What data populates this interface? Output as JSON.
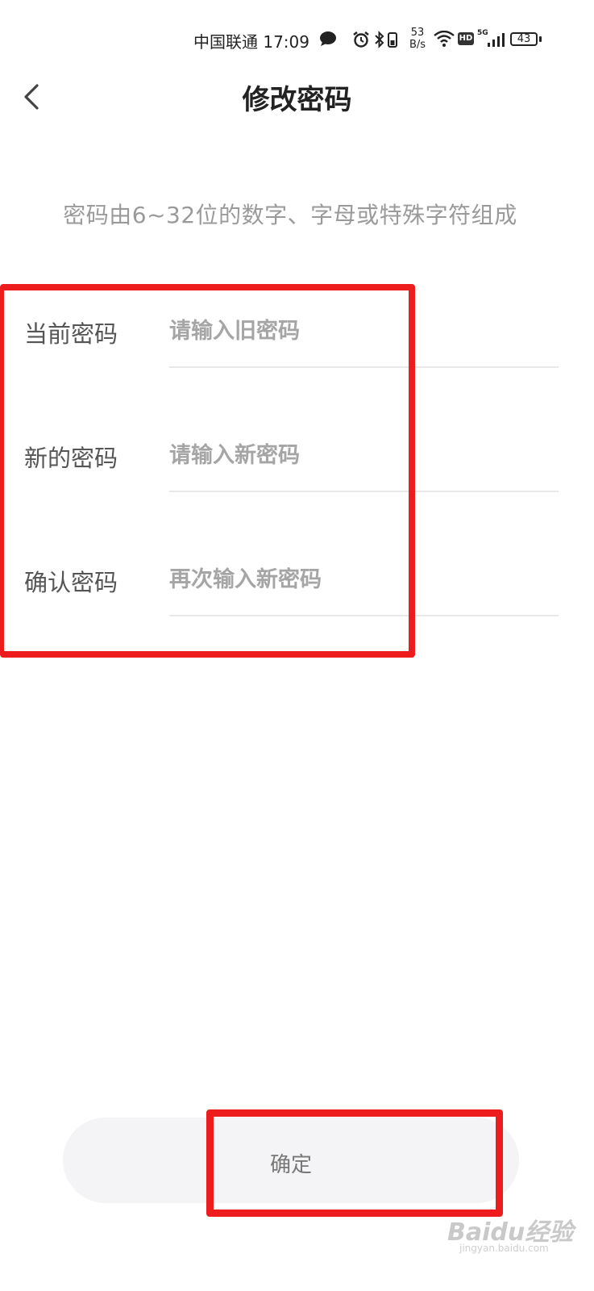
{
  "status_bar": {
    "carrier_time": "中国联通 17:09",
    "net_speed_value": "53",
    "net_speed_unit": "B/s",
    "hd": "HD",
    "signal_label": "5G",
    "battery": "43"
  },
  "header": {
    "title": "修改密码",
    "back_icon": "chevron-left-icon"
  },
  "hint": "密码由6~32位的数字、字母或特殊字符组成",
  "form": {
    "current": {
      "label": "当前密码",
      "placeholder": "请输入旧密码"
    },
    "new": {
      "label": "新的密码",
      "placeholder": "请输入新密码"
    },
    "confirm": {
      "label": "确认密码",
      "placeholder": "再次输入新密码"
    }
  },
  "confirm_button": {
    "label": "确定"
  },
  "watermark": {
    "text": "Baidu经验",
    "sub": "jingyan.baidu.com"
  },
  "colors": {
    "annotation_red": "#ee1d1d",
    "button_bg": "#f4f4f6",
    "hint_gray": "#9a9a9a"
  }
}
